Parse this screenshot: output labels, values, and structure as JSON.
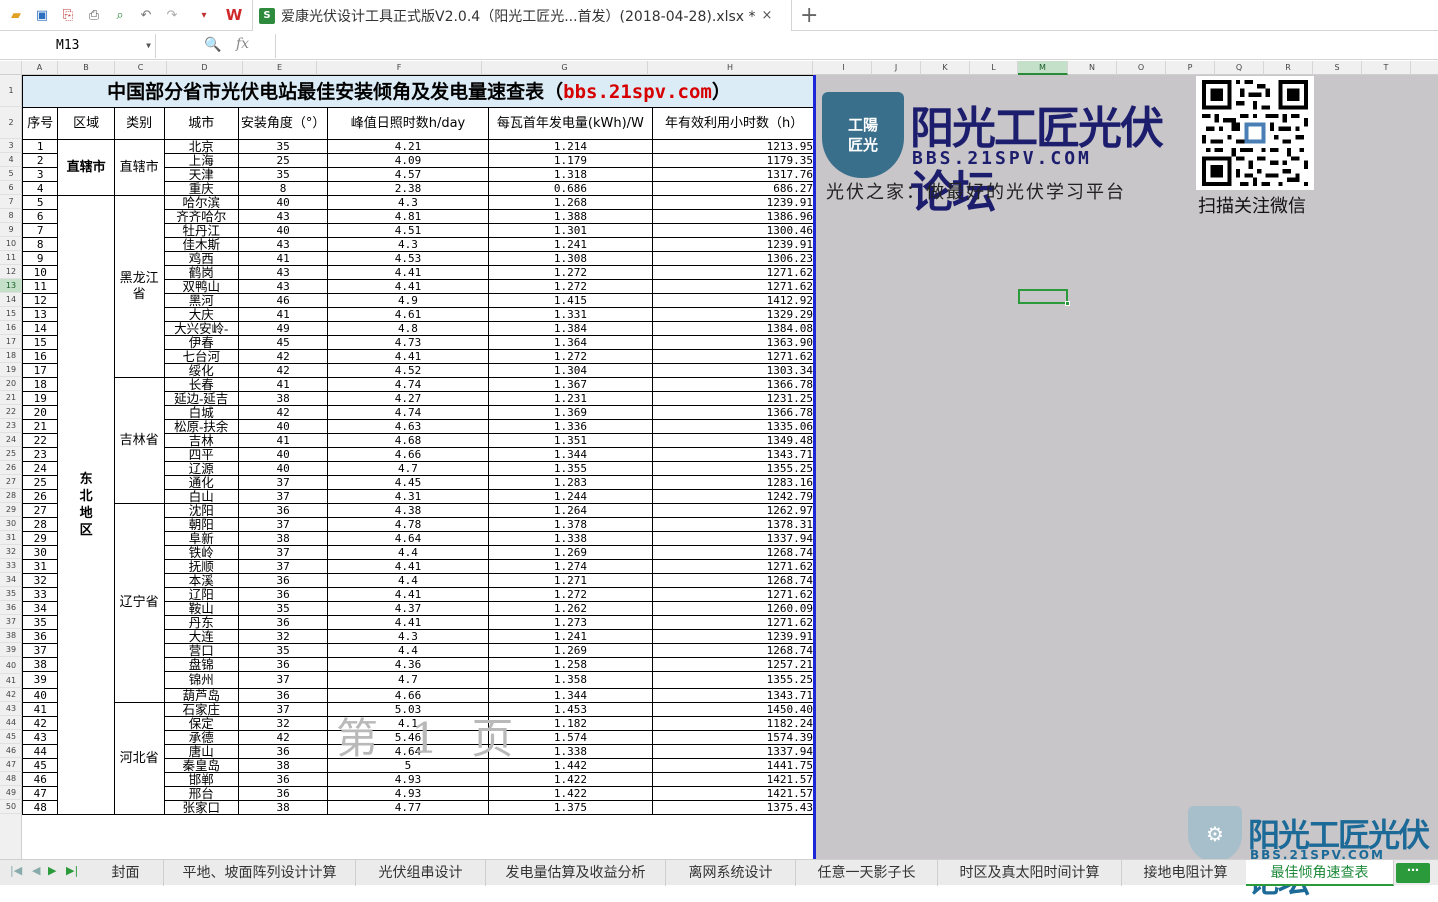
{
  "titlebar": {
    "doc_title": "爱康光伏设计工具正式版V2.0.4（阳光工匠光...首发）(2018-04-28).xlsx *",
    "close": "×",
    "new_tab": "+"
  },
  "formula": {
    "cell_ref": "M13",
    "fx": "fx",
    "value": ""
  },
  "col_letters": [
    "A",
    "B",
    "C",
    "D",
    "E",
    "F",
    "G",
    "H",
    "I",
    "J",
    "K",
    "L",
    "M",
    "N",
    "O",
    "P",
    "Q",
    "R",
    "S",
    "T"
  ],
  "row_numbers": [
    "1",
    "2",
    "3",
    "4",
    "5",
    "6",
    "7",
    "8",
    "9",
    "10",
    "11",
    "12",
    "13",
    "14",
    "15",
    "16",
    "17",
    "18",
    "19",
    "20",
    "21",
    "22",
    "23",
    "24",
    "25",
    "26",
    "27",
    "28",
    "29",
    "30",
    "31",
    "32",
    "33",
    "34",
    "35",
    "36",
    "37",
    "38",
    "39",
    "40",
    "41",
    "42",
    "43",
    "44",
    "45",
    "46",
    "47",
    "48",
    "49",
    "50"
  ],
  "sheet": {
    "title": "中国部分省市光伏电站最佳安装倾角及发电量速查表（",
    "title_web": "bbs.21spv.com",
    "title_end": "）",
    "headers": [
      "序号",
      "区域",
      "类别",
      "城市",
      "安装角度（°）",
      "峰值日照时数h/day",
      "每瓦首年发电量(kWh)/W",
      "年有效利用小时数（h）"
    ],
    "regions": [
      "直辖市",
      "东北地区"
    ],
    "categories": [
      "直辖市",
      "黑龙江省",
      "吉林省",
      "辽宁省",
      "河北省"
    ],
    "rows": [
      [
        "1",
        "北京",
        "35",
        "4.21",
        "1.214",
        "1213.95"
      ],
      [
        "2",
        "上海",
        "25",
        "4.09",
        "1.179",
        "1179.35"
      ],
      [
        "3",
        "天津",
        "35",
        "4.57",
        "1.318",
        "1317.76"
      ],
      [
        "4",
        "重庆",
        "8",
        "2.38",
        "0.686",
        "686.27"
      ],
      [
        "5",
        "哈尔滨",
        "40",
        "4.3",
        "1.268",
        "1239.91"
      ],
      [
        "6",
        "齐齐哈尔",
        "43",
        "4.81",
        "1.388",
        "1386.96"
      ],
      [
        "7",
        "牡丹江",
        "40",
        "4.51",
        "1.301",
        "1300.46"
      ],
      [
        "8",
        "佳木斯",
        "43",
        "4.3",
        "1.241",
        "1239.91"
      ],
      [
        "9",
        "鸡西",
        "41",
        "4.53",
        "1.308",
        "1306.23"
      ],
      [
        "10",
        "鹤岗",
        "43",
        "4.41",
        "1.272",
        "1271.62"
      ],
      [
        "11",
        "双鸭山",
        "43",
        "4.41",
        "1.272",
        "1271.62"
      ],
      [
        "12",
        "黑河",
        "46",
        "4.9",
        "1.415",
        "1412.92"
      ],
      [
        "13",
        "大庆",
        "41",
        "4.61",
        "1.331",
        "1329.29"
      ],
      [
        "14",
        "大兴安岭-",
        "49",
        "4.8",
        "1.384",
        "1384.08"
      ],
      [
        "15",
        "伊春",
        "45",
        "4.73",
        "1.364",
        "1363.90"
      ],
      [
        "16",
        "七台河",
        "42",
        "4.41",
        "1.272",
        "1271.62"
      ],
      [
        "17",
        "绥化",
        "42",
        "4.52",
        "1.304",
        "1303.34"
      ],
      [
        "18",
        "长春",
        "41",
        "4.74",
        "1.367",
        "1366.78"
      ],
      [
        "19",
        "延边-延吉",
        "38",
        "4.27",
        "1.231",
        "1231.25"
      ],
      [
        "20",
        "白城",
        "42",
        "4.74",
        "1.369",
        "1366.78"
      ],
      [
        "21",
        "松原-扶余",
        "40",
        "4.63",
        "1.336",
        "1335.06"
      ],
      [
        "22",
        "吉林",
        "41",
        "4.68",
        "1.351",
        "1349.48"
      ],
      [
        "23",
        "四平",
        "40",
        "4.66",
        "1.344",
        "1343.71"
      ],
      [
        "24",
        "辽源",
        "40",
        "4.7",
        "1.355",
        "1355.25"
      ],
      [
        "25",
        "通化",
        "37",
        "4.45",
        "1.283",
        "1283.16"
      ],
      [
        "26",
        "白山",
        "37",
        "4.31",
        "1.244",
        "1242.79"
      ],
      [
        "27",
        "沈阳",
        "36",
        "4.38",
        "1.264",
        "1262.97"
      ],
      [
        "28",
        "朝阳",
        "37",
        "4.78",
        "1.378",
        "1378.31"
      ],
      [
        "29",
        "阜新",
        "38",
        "4.64",
        "1.338",
        "1337.94"
      ],
      [
        "30",
        "铁岭",
        "37",
        "4.4",
        "1.269",
        "1268.74"
      ],
      [
        "31",
        "抚顺",
        "37",
        "4.41",
        "1.274",
        "1271.62"
      ],
      [
        "32",
        "本溪",
        "36",
        "4.4",
        "1.271",
        "1268.74"
      ],
      [
        "33",
        "辽阳",
        "36",
        "4.41",
        "1.272",
        "1271.62"
      ],
      [
        "34",
        "鞍山",
        "35",
        "4.37",
        "1.262",
        "1260.09"
      ],
      [
        "35",
        "丹东",
        "36",
        "4.41",
        "1.273",
        "1271.62"
      ],
      [
        "36",
        "大连",
        "32",
        "4.3",
        "1.241",
        "1239.91"
      ],
      [
        "37",
        "营口",
        "35",
        "4.4",
        "1.269",
        "1268.74"
      ],
      [
        "38",
        "盘锦",
        "36",
        "4.36",
        "1.258",
        "1257.21"
      ],
      [
        "39",
        "锦州",
        "37",
        "4.7",
        "1.358",
        "1355.25"
      ],
      [
        "40",
        "葫芦岛",
        "36",
        "4.66",
        "1.344",
        "1343.71"
      ],
      [
        "41",
        "石家庄",
        "37",
        "5.03",
        "1.453",
        "1450.40"
      ],
      [
        "42",
        "保定",
        "32",
        "4.1",
        "1.182",
        "1182.24"
      ],
      [
        "43",
        "承德",
        "42",
        "5.46",
        "1.574",
        "1574.39"
      ],
      [
        "44",
        "唐山",
        "36",
        "4.64",
        "1.338",
        "1337.94"
      ],
      [
        "45",
        "秦皇岛",
        "38",
        "5",
        "1.442",
        "1441.75"
      ],
      [
        "46",
        "邯郸",
        "36",
        "4.93",
        "1.422",
        "1421.57"
      ],
      [
        "47",
        "邢台",
        "36",
        "4.93",
        "1.422",
        "1421.57"
      ],
      [
        "48",
        "张家口",
        "38",
        "4.77",
        "1.375",
        "1375.43"
      ]
    ]
  },
  "page_mark": "第 1 页",
  "logo": {
    "badge_line1": "工陽",
    "badge_line2": "匠光",
    "title": "阳光工匠光伏论坛",
    "url": "BBS.21SPV.COM",
    "tagline": "光伏之家：做最好的光伏学习平台"
  },
  "qr_caption": "扫描关注微信",
  "watermark": {
    "title": "阳光工匠光伏论坛",
    "url": "BBS.21SPV.COM"
  },
  "sheet_tabs": [
    "封面",
    "平地、坡面阵列设计计算",
    "光伏组串设计",
    "发电量估算及收益分析",
    "离网系统设计",
    "任意一天影子长",
    "时区及真太阳时间计算",
    "接地电阻计算",
    "最佳倾角速查表"
  ],
  "more_tabs": "⋯",
  "colors": {
    "accent": "#2a9a3a",
    "title_bg": "#dcecf7",
    "border_blue": "#1c28d8",
    "grey_area": "#c8c6c9"
  }
}
